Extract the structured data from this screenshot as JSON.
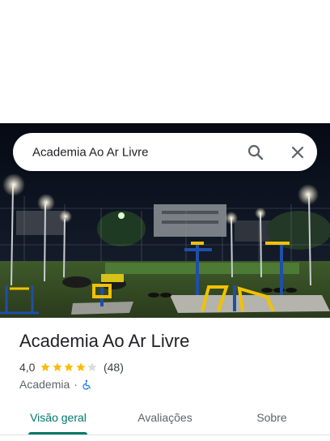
{
  "search": {
    "query": "Academia Ao Ar Livre"
  },
  "place": {
    "name": "Academia Ao Ar Livre",
    "rating": "4,0",
    "stars": 4,
    "max_stars": 5,
    "review_count": "(48)",
    "category": "Academia",
    "separator": "·",
    "accessibility_icon": "wheelchair-accessible-icon"
  },
  "tabs": [
    {
      "label": "Visão geral",
      "active": true
    },
    {
      "label": "Avaliações",
      "active": false
    },
    {
      "label": "Sobre",
      "active": false
    }
  ],
  "colors": {
    "accent": "#00796b",
    "star": "#fbbc04",
    "star_empty": "#dadce0",
    "wheelchair": "#1a73e8"
  }
}
